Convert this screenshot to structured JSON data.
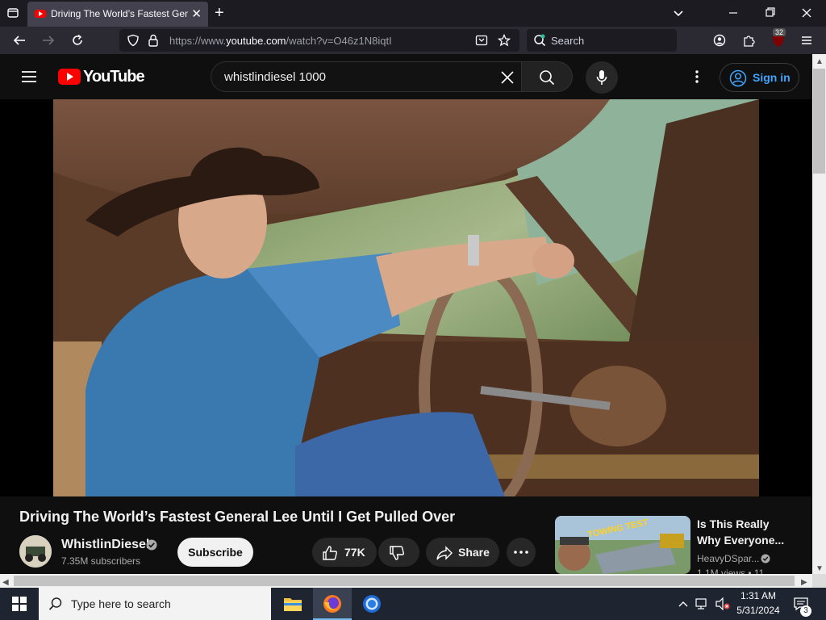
{
  "browser": {
    "tab_title": "Driving The World’s Fastest General Lee Until I Get Pulled Over",
    "url_prefix": "https://www.",
    "url_domain": "youtube.com",
    "url_suffix": "/watch?v=O46z1N8iqtI",
    "search_placeholder": "Search",
    "extensions_badge": "32"
  },
  "youtube": {
    "logo_text": "YouTube",
    "search_query": "whistlindiesel 1000",
    "signin_label": "Sign in"
  },
  "video": {
    "title": "Driving The World’s Fastest General Lee Until I Get Pulled Over",
    "channel_name": "WhistlinDiesel",
    "subscribers": "7.35M subscribers",
    "subscribe_label": "Subscribe",
    "likes": "77K",
    "share_label": "Share"
  },
  "recommendation": {
    "title_line1": "Is This Really",
    "title_line2": "Why Everyone...",
    "channel": "HeavyDSpar...",
    "meta": "1.1M views • 11",
    "thumb_text": "TOWING TEST"
  },
  "taskbar": {
    "search_placeholder": "Type here to search",
    "time": "1:31 AM",
    "date": "5/31/2024",
    "notification_count": "3"
  },
  "colors": {
    "youtube_red": "#ff0000",
    "signin_blue": "#3ea6ff",
    "browser_dark": "#1c1b22"
  }
}
